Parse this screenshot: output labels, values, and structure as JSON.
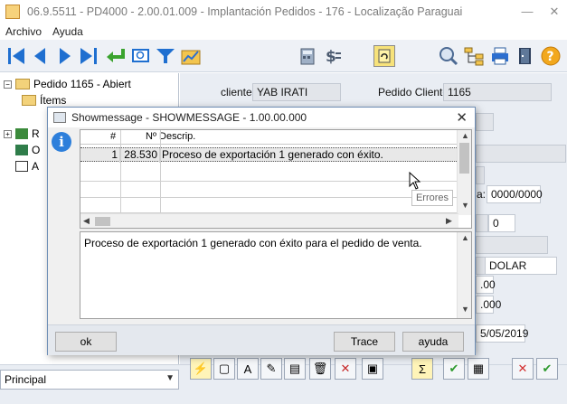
{
  "window": {
    "title": "06.9.5511 - PD4000 - 2.00.01.009 - Implantación Pedidos - 176 - Localização Paraguai",
    "minimize": "—",
    "close": "✕"
  },
  "menu": [
    "Archivo",
    "Ayuda"
  ],
  "tree": {
    "root_label": "Pedido 1165 - Abiert",
    "child_label": "Ítems",
    "other_items": [
      "R",
      "O",
      "A"
    ]
  },
  "form": {
    "cliente_label": "cliente:",
    "cliente_value": "YAB IRATI",
    "pedido_cliente_label": "Pedido Cliente:",
    "pedido_cliente_value": "1165",
    "fecha_label": "a:",
    "fecha_value": "0000/0000",
    "field_zero": "0",
    "moneda_value": "DOLAR",
    "val1": ".00",
    "val2": ".000",
    "date_value": "5/05/2019"
  },
  "bottom": {
    "select_value": "Principal"
  },
  "dialog": {
    "title": "Showmessage - SHOWMESSAGE - 1.00.00.000",
    "close": "✕",
    "columns": [
      "#",
      "Nº Descrip."
    ],
    "rows": [
      {
        "num": "1",
        "code": "28.530",
        "desc": "Proceso de exportación 1 generado con éxito."
      }
    ],
    "tooltip": "Errores",
    "memo_text": "Proceso de exportación 1 generado con éxito para el pedido de venta.",
    "ok_label": "ok",
    "trace_label": "Trace",
    "help_label": "ayuda"
  },
  "colors": {
    "nav_blue": "#1f6fd0",
    "selection_row": "#e8e8e8",
    "info_blue": "#2d7fdb"
  }
}
